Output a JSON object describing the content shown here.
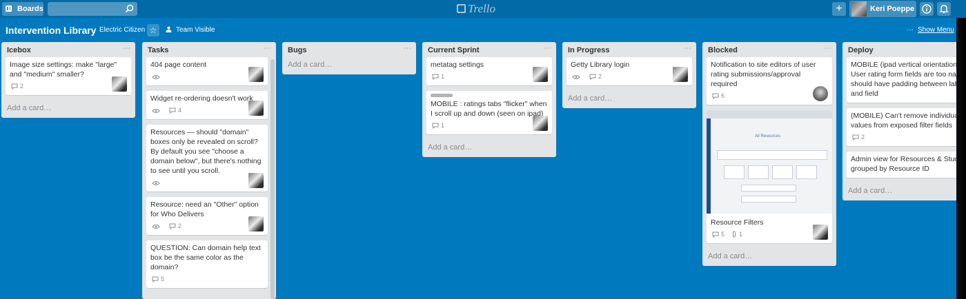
{
  "topbar": {
    "boards_label": "Boards",
    "search_placeholder": "",
    "logo_text": "Trello",
    "add_label": "+",
    "user_name": "Keri Poeppe"
  },
  "board": {
    "title": "Intervention Library",
    "org": "Electric Citizen",
    "star": "☆",
    "visibility": "Team Visible",
    "menu_dots": "···",
    "show_menu": "Show Menu"
  },
  "common": {
    "add_card": "Add a card…",
    "list_menu": "···"
  },
  "lists": {
    "icebox": {
      "title": "Icebox",
      "cards": [
        {
          "title": "Image size settings: make \"large\" and \"medium\" smaller?",
          "comments": "2"
        }
      ]
    },
    "tasks": {
      "title": "Tasks",
      "cards": [
        {
          "title": "404 page content"
        },
        {
          "title": "Widget re-ordering doesn't work",
          "comments": "4"
        },
        {
          "title": "Resources — should \"domain\" boxes only be revealed on scroll? By default you see \"choose a domain below\", but there's nothing to see until you scroll."
        },
        {
          "title": "Resource: need an \"Other\" option for Who Delivers",
          "comments": "2"
        },
        {
          "title": "QUESTION: Can domain help text box be the same color as the domain?",
          "comments": "5"
        }
      ]
    },
    "bugs": {
      "title": "Bugs"
    },
    "current_sprint": {
      "title": "Current Sprint",
      "cards": [
        {
          "title": "metatag settings",
          "comments": "1"
        },
        {
          "title": "MOBILE : ratings tabs \"flicker\" when I scroll up and down (seen on ipad)",
          "comments": "1"
        }
      ]
    },
    "in_progress": {
      "title": "In Progress",
      "cards": [
        {
          "title": "Getty Library login",
          "comments": "2"
        }
      ]
    },
    "blocked": {
      "title": "Blocked",
      "cards": [
        {
          "title": "Notification to site editors of user rating submissions/approval required",
          "comments": "6"
        },
        {
          "title": "Resource Filters",
          "comments": "5",
          "attachments": "1",
          "cover_title": "All Resources"
        }
      ]
    },
    "deploy": {
      "title": "Deploy",
      "cards": [
        {
          "title": "MOBILE (ipad vertical orientation) User rating form fields are too narr should have padding between labe and field"
        },
        {
          "title": "(MOBILE) Can't remove individual values from exposed filter fields",
          "comments": "2"
        },
        {
          "title": "Admin view for Resources & Studi grouped by Resource ID"
        }
      ]
    }
  }
}
